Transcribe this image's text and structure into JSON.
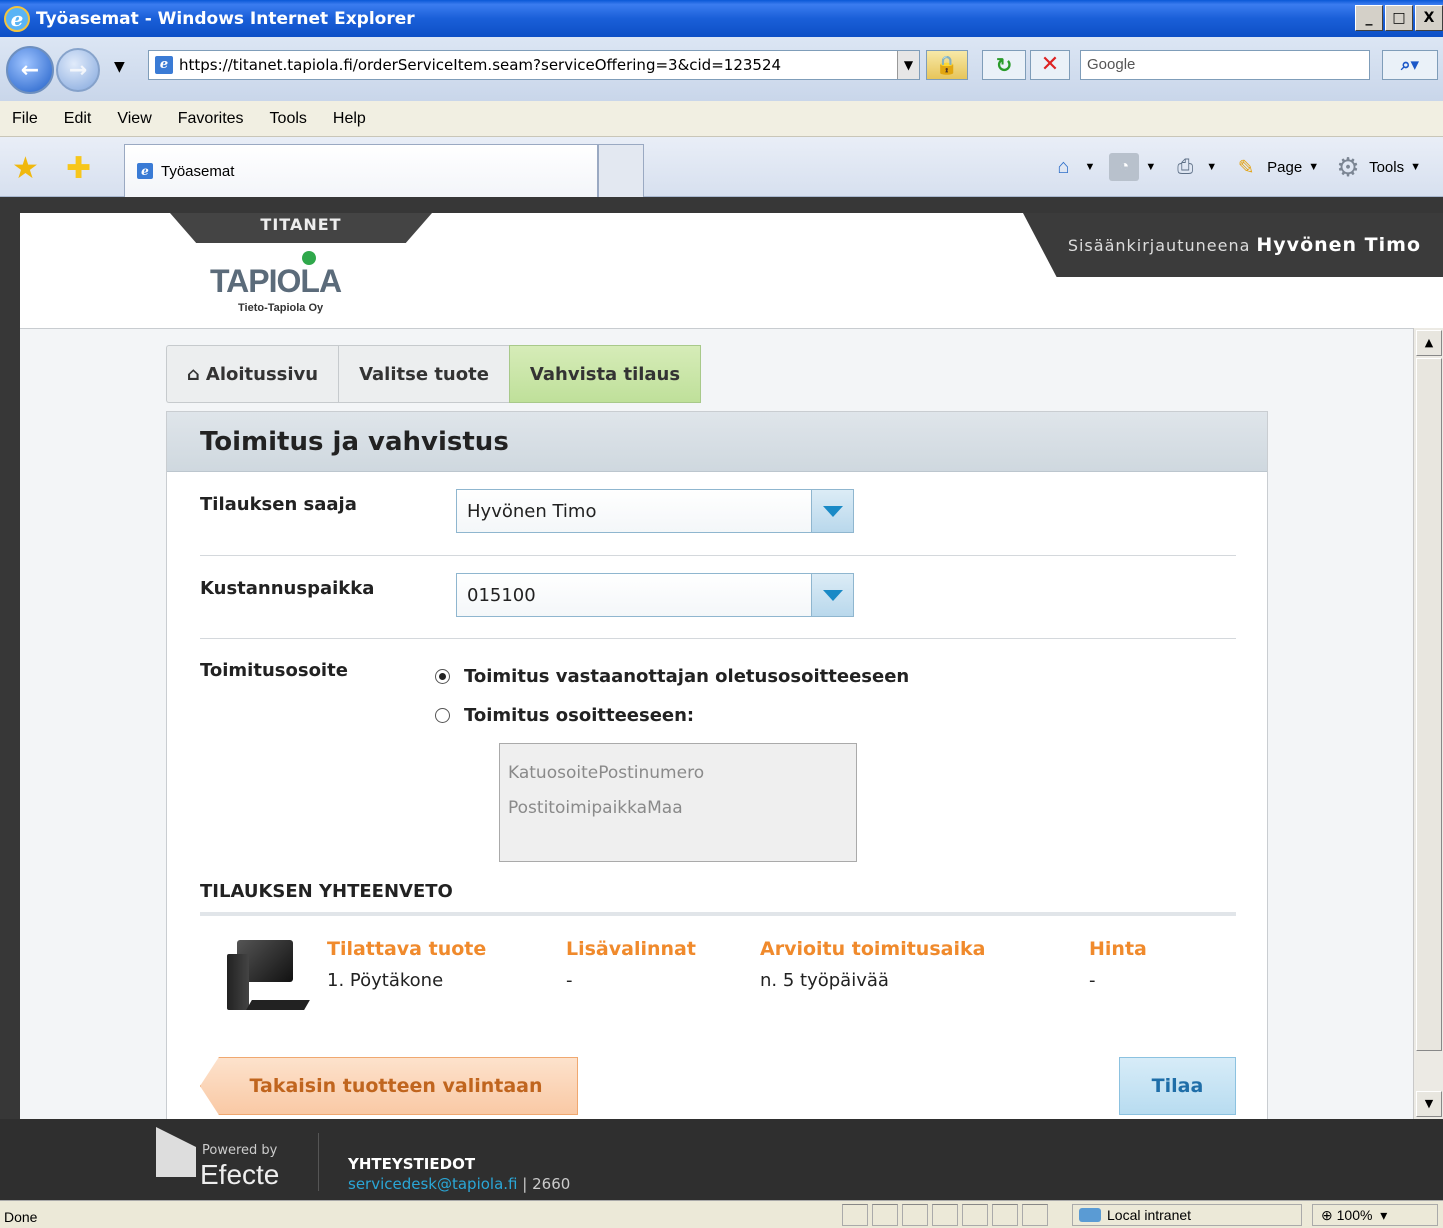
{
  "window": {
    "title": "Työasemat - Windows Internet Explorer",
    "min": "_",
    "max": "□",
    "close": "X"
  },
  "addressbar": {
    "url": "https://titanet.tapiola.fi/orderServiceItem.seam?serviceOffering=3&cid=123524",
    "search_placeholder": "Google"
  },
  "menu": [
    "File",
    "Edit",
    "View",
    "Favorites",
    "Tools",
    "Help"
  ],
  "tab": {
    "label": "Työasemat"
  },
  "commandbar": {
    "page": "Page",
    "tools": "Tools"
  },
  "header": {
    "tab_label": "TITANET",
    "logo_text": "TAPIOLA",
    "logo_sub": "Tieto-Tapiola Oy",
    "logged_in_prefix": "Sisäänkirjautuneena",
    "user_name": "Hyvönen Timo"
  },
  "breadcrumb": [
    "Aloitussivu",
    "Valitse tuote",
    "Vahvista tilaus"
  ],
  "panel": {
    "title": "Toimitus ja vahvistus",
    "recipient": {
      "label": "Tilauksen saaja",
      "value": "Hyvönen Timo"
    },
    "cost_center": {
      "label": "Kustannuspaikka",
      "value": "015100"
    },
    "delivery": {
      "label": "Toimitusosoite",
      "options": [
        "Toimitus vastaanottajan oletusosoitteeseen",
        "Toimitus osoitteeseen:"
      ],
      "selected": 0,
      "address_lines": [
        "KatuosoitePostinumero",
        "PostitoimipaikkaMaa"
      ]
    }
  },
  "summary": {
    "title": "TILAUKSEN YHTEENVETO",
    "columns": [
      {
        "header": "Tilattava tuote",
        "value": "1. Pöytäkone"
      },
      {
        "header": "Lisävalinnat",
        "value": "-"
      },
      {
        "header": "Arvioitu toimitusaika",
        "value": "n. 5 työpäivää"
      },
      {
        "header": "Hinta",
        "value": "-"
      }
    ]
  },
  "buttons": {
    "back": "Takaisin tuotteen valintaan",
    "order": "Tilaa"
  },
  "footer": {
    "powered_by": "Powered by",
    "brand": "Efecte",
    "contact_title": "YHTEYSTIEDOT",
    "email": "servicedesk@tapiola.fi",
    "phone": "| 2660"
  },
  "statusbar": {
    "status": "Done",
    "zone": "Local intranet",
    "zoom": "100%"
  },
  "colors": {
    "accent_orange": "#f08a2c",
    "active_crumb": "#c8e6a6",
    "select_border": "#8fb6cf",
    "ie_blue": "#1a5fd8"
  }
}
